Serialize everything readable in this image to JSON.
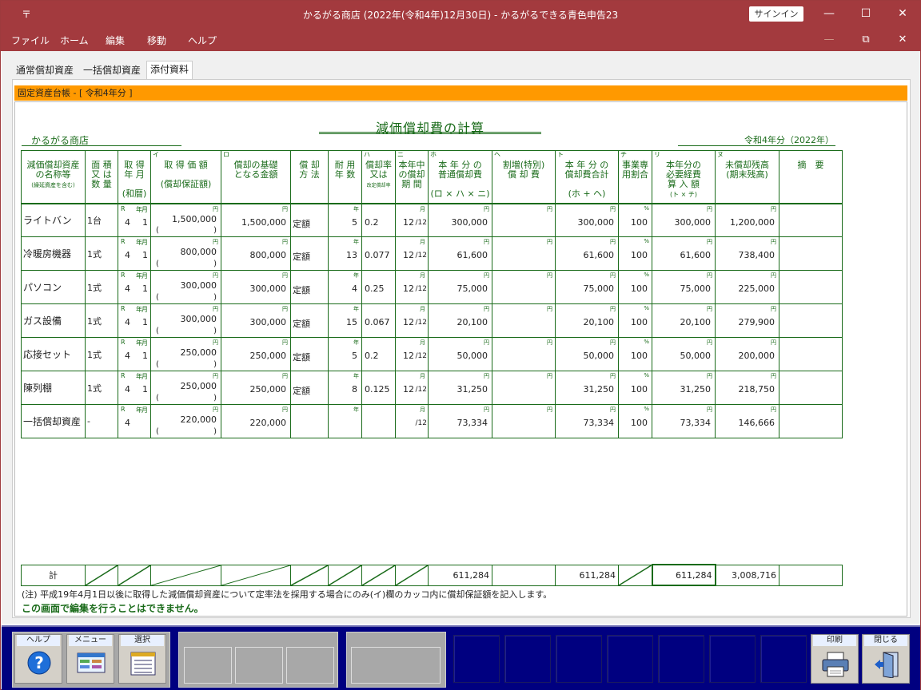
{
  "window": {
    "title": "かるがる商店 (2022年(令和4年)12月30日)  -  かるがるできる青色申告23",
    "sysmenu": "〒",
    "signin": "サインイン",
    "min": "—",
    "max": "☐",
    "close": "✕"
  },
  "menu": [
    "ファイル",
    "ホーム",
    "編集",
    "移動",
    "ヘルプ"
  ],
  "tabs": [
    "通常償却資産",
    "一括償却資産",
    "添付資料"
  ],
  "section_bar": "固定資産台帳 - [ 令和4年分 ]",
  "doc": {
    "title": "減価償却費の計算",
    "shop": "かるがる商店",
    "year": "令和4年分（2022年）"
  },
  "headers": {
    "c1": "減価償却資産\nの名称等",
    "c1s": "(繰延資産を含む)",
    "c2": "面 積\n又 は\n数 量",
    "c3": "取 得\n年 月\n\n(和暦)",
    "c4": "取 得 価 額\n\n(償却保証額)",
    "c4t": "イ",
    "c5": "償却の基礎\nとなる金額",
    "c5t": "ロ",
    "c6": "償 却\n方 法",
    "c7": "耐 用\n年 数",
    "c8": "償却率\n又は",
    "c8s": "改定償却率",
    "c8t": "ハ",
    "c9": "本年中\nの償却\n期 間",
    "c9t": "ニ",
    "c10": "本 年 分 の\n普通償却費\n\n(ロ × ハ × ニ)",
    "c10t": "ホ",
    "c11": "割増(特別)\n償 却 費",
    "c11t": "ヘ",
    "c12": "本 年 分 の\n償却費合計\n\n(ホ + ヘ)",
    "c12t": "ト",
    "c13": "事業専\n用割合",
    "c13t": "チ",
    "c14": "本年分の\n必要経費\n算 入 額",
    "c14s": "(ト × チ)",
    "c14t": "リ",
    "c15": "未償却残高\n(期末残高)",
    "c15t": "ヌ",
    "c16": "摘　要"
  },
  "units": {
    "yen": "円",
    "nen": "年",
    "tsuki": "月",
    "pct": "%",
    "r": "R",
    "per12": "/12",
    "lp": "(",
    "rp": ")"
  },
  "rows": [
    {
      "name": "ライトバン",
      "qty": "1台",
      "y": "4",
      "m": "1",
      "cost": "1,500,000",
      "base": "1,500,000",
      "method": "定額",
      "life": "5",
      "rate": "0.2",
      "months": "12",
      "dep": "300,000",
      "extra": "",
      "total": "300,000",
      "pct": "100",
      "exp": "300,000",
      "remain": "1,200,000"
    },
    {
      "name": "冷暖房機器",
      "qty": "1式",
      "y": "4",
      "m": "1",
      "cost": "800,000",
      "base": "800,000",
      "method": "定額",
      "life": "13",
      "rate": "0.077",
      "months": "12",
      "dep": "61,600",
      "extra": "",
      "total": "61,600",
      "pct": "100",
      "exp": "61,600",
      "remain": "738,400"
    },
    {
      "name": "パソコン",
      "qty": "1式",
      "y": "4",
      "m": "1",
      "cost": "300,000",
      "base": "300,000",
      "method": "定額",
      "life": "4",
      "rate": "0.25",
      "months": "12",
      "dep": "75,000",
      "extra": "",
      "total": "75,000",
      "pct": "100",
      "exp": "75,000",
      "remain": "225,000"
    },
    {
      "name": "ガス設備",
      "qty": "1式",
      "y": "4",
      "m": "1",
      "cost": "300,000",
      "base": "300,000",
      "method": "定額",
      "life": "15",
      "rate": "0.067",
      "months": "12",
      "dep": "20,100",
      "extra": "",
      "total": "20,100",
      "pct": "100",
      "exp": "20,100",
      "remain": "279,900"
    },
    {
      "name": "応接セット",
      "qty": "1式",
      "y": "4",
      "m": "1",
      "cost": "250,000",
      "base": "250,000",
      "method": "定額",
      "life": "5",
      "rate": "0.2",
      "months": "12",
      "dep": "50,000",
      "extra": "",
      "total": "50,000",
      "pct": "100",
      "exp": "50,000",
      "remain": "200,000"
    },
    {
      "name": "陳列棚",
      "qty": "1式",
      "y": "4",
      "m": "1",
      "cost": "250,000",
      "base": "250,000",
      "method": "定額",
      "life": "8",
      "rate": "0.125",
      "months": "12",
      "dep": "31,250",
      "extra": "",
      "total": "31,250",
      "pct": "100",
      "exp": "31,250",
      "remain": "218,750"
    },
    {
      "name": "一括償却資産",
      "qty": "-",
      "y": "4",
      "m": "",
      "cost": "220,000",
      "base": "220,000",
      "method": "",
      "life": "",
      "rate": "",
      "months": "",
      "dep": "73,334",
      "extra": "",
      "total": "73,334",
      "pct": "100",
      "exp": "73,334",
      "remain": "146,666"
    }
  ],
  "totals": {
    "label": "計",
    "dep": "611,284",
    "total": "611,284",
    "exp": "611,284",
    "remain": "3,008,716"
  },
  "note": "(注)  平成19年4月1日以後に取得した減価償却資産について定率法を採用する場合にのみ(イ)欄のカッコ内に償却保証額を記入します。",
  "warning": "この画面で編集を行うことはできません。",
  "toolbar": {
    "help": "ヘルプ",
    "menu": "メニュー",
    "select": "選択",
    "print": "印刷",
    "close": "閉じる"
  },
  "colors": {
    "titlebar": "#a33a3e",
    "accent": "#ff9900",
    "ink": "#1a6b1a",
    "toolbar": "#000080"
  }
}
